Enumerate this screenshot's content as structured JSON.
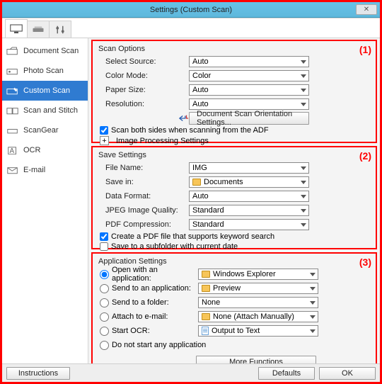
{
  "window": {
    "title": "Settings (Custom Scan)"
  },
  "sidebar": {
    "items": [
      {
        "label": "Document Scan"
      },
      {
        "label": "Photo Scan"
      },
      {
        "label": "Custom Scan"
      },
      {
        "label": "Scan and Stitch"
      },
      {
        "label": "ScanGear"
      },
      {
        "label": "OCR"
      },
      {
        "label": "E-mail"
      }
    ]
  },
  "groups": {
    "scan": {
      "title": "Scan Options",
      "num": "(1)",
      "select_source_label": "Select Source:",
      "select_source_value": "Auto",
      "color_mode_label": "Color Mode:",
      "color_mode_value": "Color",
      "paper_size_label": "Paper Size:",
      "paper_size_value": "Auto",
      "resolution_label": "Resolution:",
      "resolution_value": "Auto",
      "orientation_btn": "Document Scan Orientation Settings...",
      "scan_both_label": "Scan both sides when scanning from the ADF",
      "img_proc_label": "Image Processing Settings"
    },
    "save": {
      "title": "Save Settings",
      "num": "(2)",
      "file_name_label": "File Name:",
      "file_name_value": "IMG",
      "save_in_label": "Save in:",
      "save_in_value": "Documents",
      "data_format_label": "Data Format:",
      "data_format_value": "Auto",
      "jpeg_q_label": "JPEG Image Quality:",
      "jpeg_q_value": "Standard",
      "pdf_comp_label": "PDF Compression:",
      "pdf_comp_value": "Standard",
      "create_pdf_label": "Create a PDF file that supports keyword search",
      "save_subfolder_label": "Save to a subfolder with current date"
    },
    "app": {
      "title": "Application Settings",
      "num": "(3)",
      "open_app_label": "Open with an application:",
      "open_app_value": "Windows Explorer",
      "send_app_label": "Send to an application:",
      "send_app_value": "Preview",
      "send_folder_label": "Send to a folder:",
      "send_folder_value": "None",
      "attach_email_label": "Attach to e-mail:",
      "attach_email_value": "None (Attach Manually)",
      "start_ocr_label": "Start OCR:",
      "start_ocr_value": "Output to Text",
      "no_start_label": "Do not start any application",
      "more_functions_btn": "More Functions"
    }
  },
  "footer": {
    "instructions": "Instructions",
    "defaults": "Defaults",
    "ok": "OK"
  }
}
